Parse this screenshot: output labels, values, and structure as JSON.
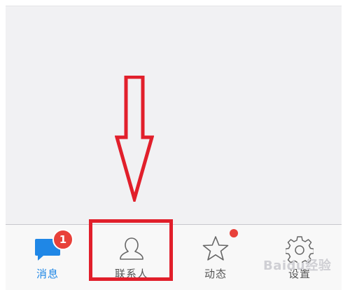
{
  "tabbar": {
    "tabs": [
      {
        "label": "消息",
        "icon": "chat-bubble-icon",
        "active": true,
        "badge": "1"
      },
      {
        "label": "联系人",
        "icon": "person-icon",
        "active": false
      },
      {
        "label": "动态",
        "icon": "star-icon",
        "active": false,
        "has_dot": true
      },
      {
        "label": "设置",
        "icon": "gear-icon",
        "active": false
      }
    ]
  },
  "watermark": {
    "text": "Baidu经验"
  },
  "colors": {
    "accent": "#1f87e6",
    "badge": "#e8413a",
    "annotation": "#e11f2b"
  }
}
